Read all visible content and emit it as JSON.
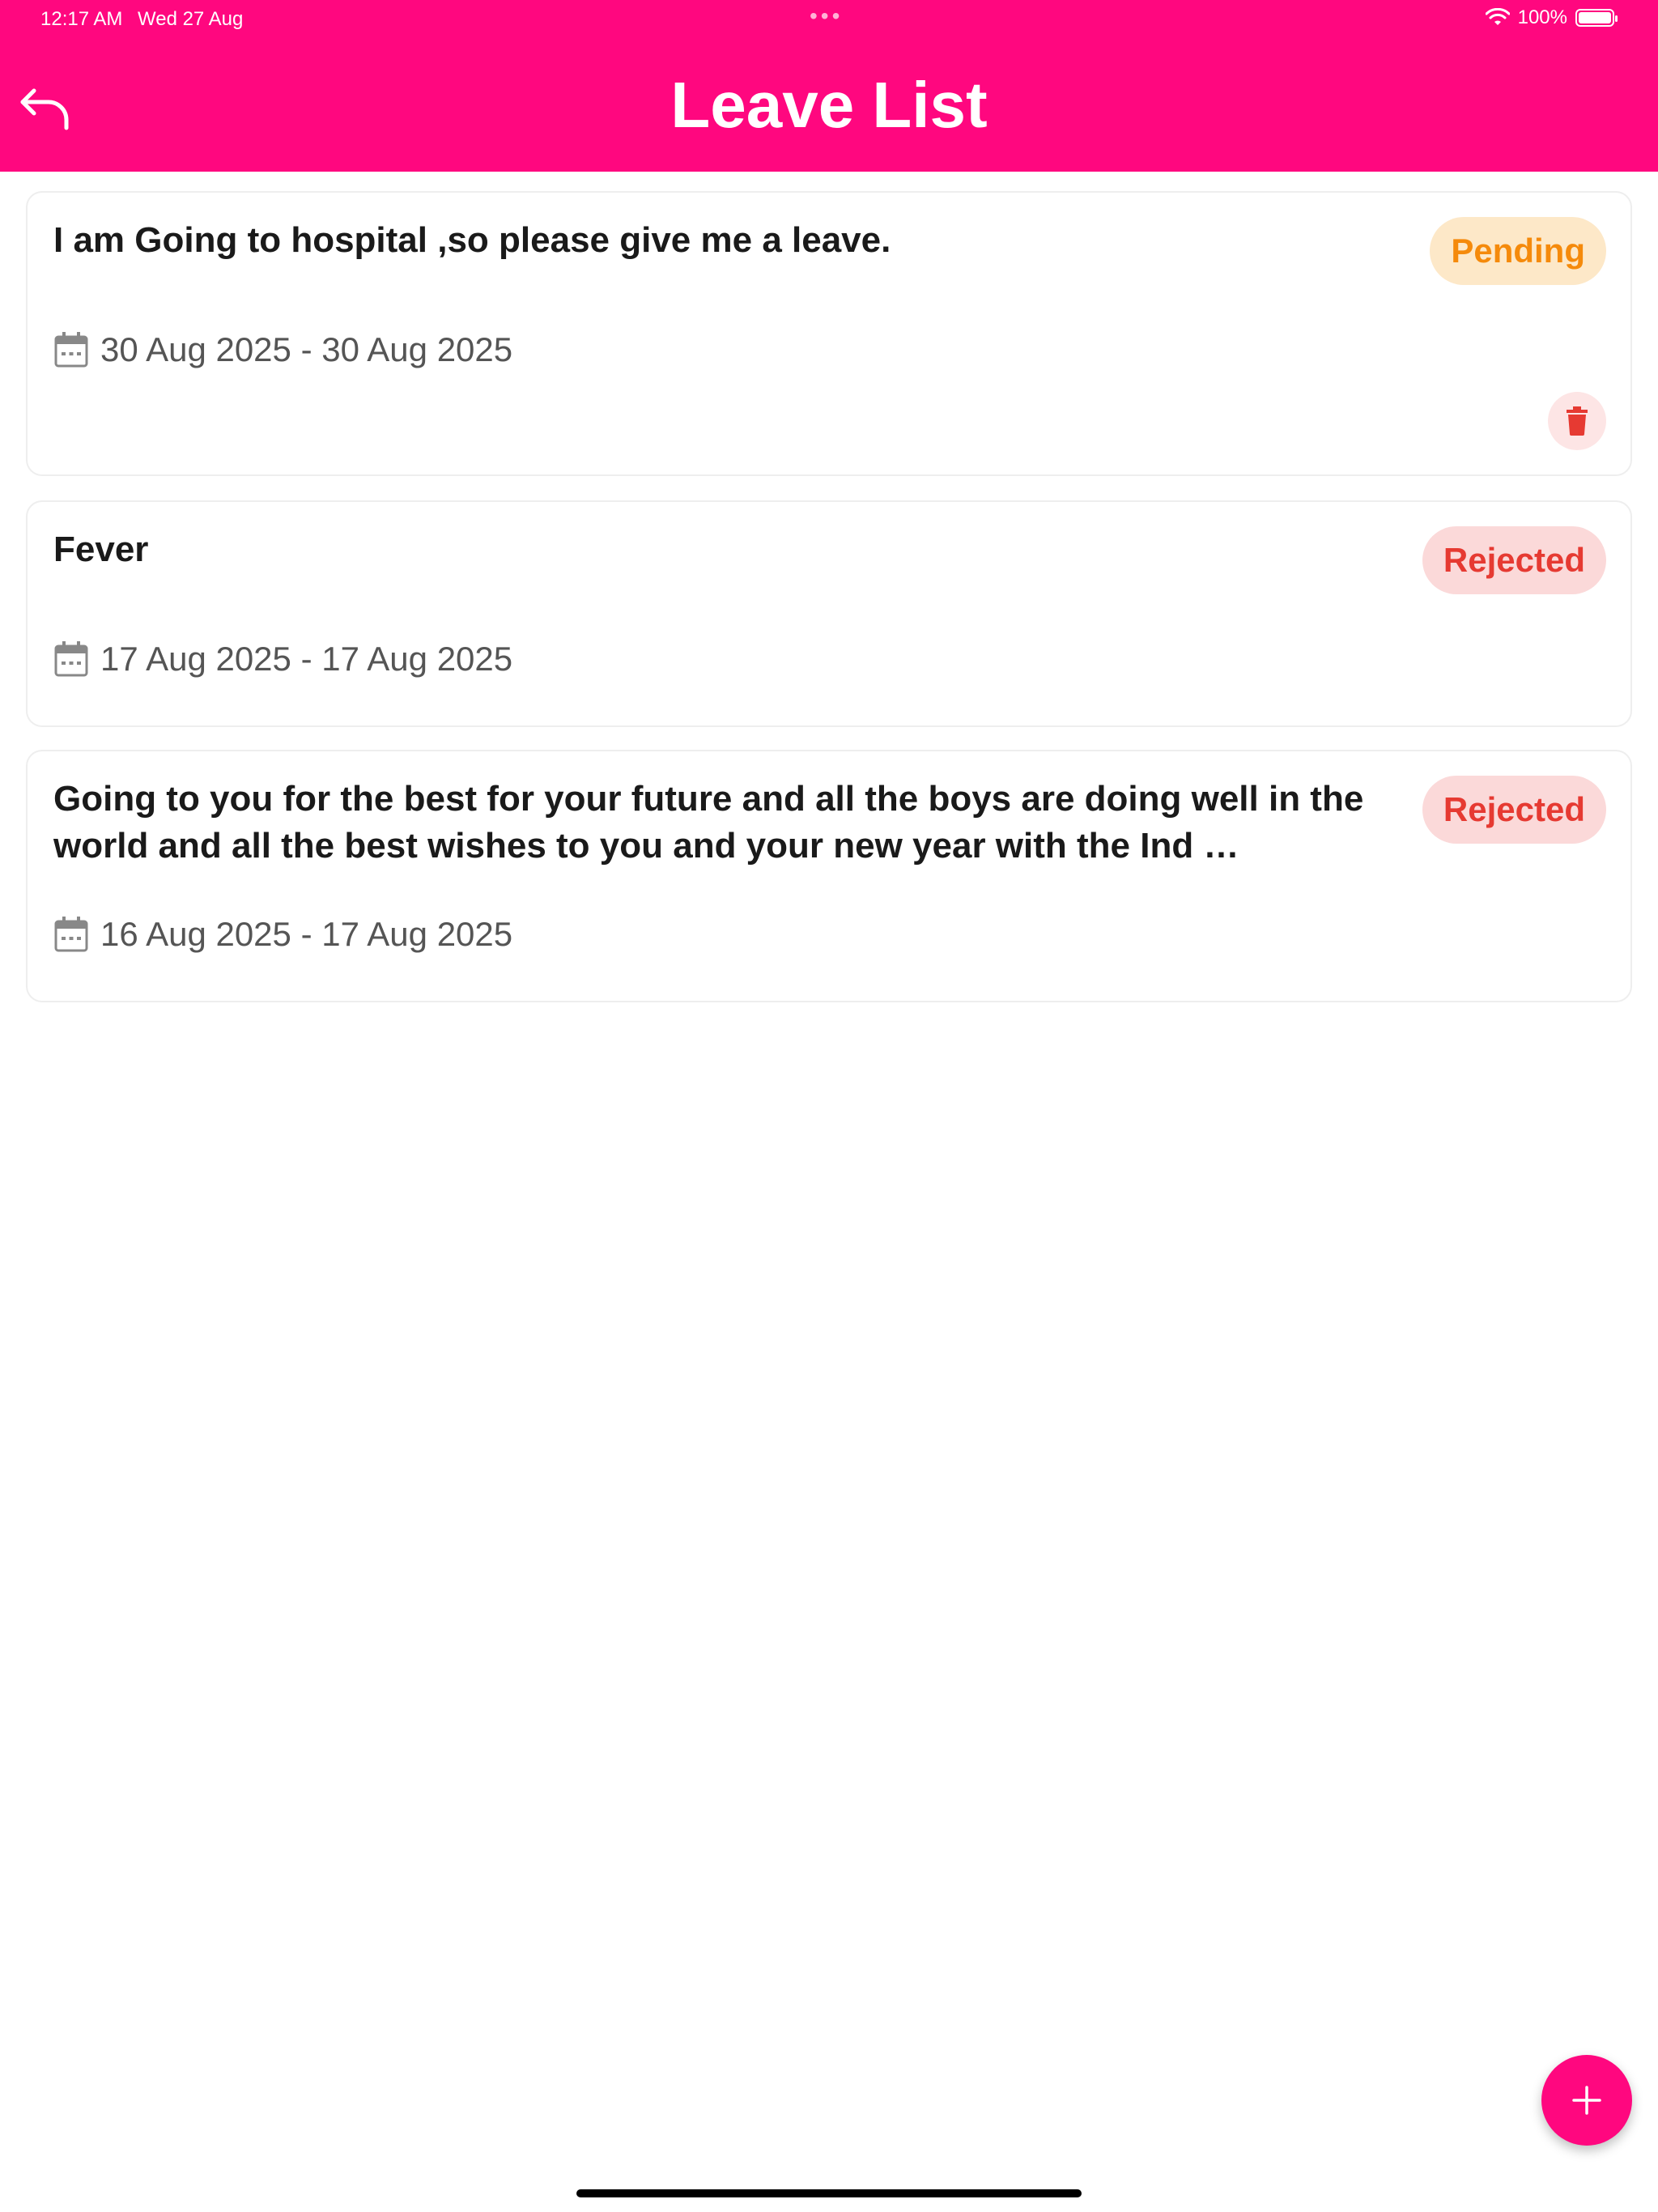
{
  "status_bar": {
    "time": "12:17 AM",
    "date": "Wed 27 Aug",
    "battery": "100%"
  },
  "header": {
    "title": "Leave List"
  },
  "leaves": [
    {
      "reason": "I am Going to hospital ,so please give me a  leave.",
      "status": "Pending",
      "dates": "30 Aug 2025 - 30 Aug 2025"
    },
    {
      "reason": "Fever",
      "status": "Rejected",
      "dates": "17 Aug 2025 - 17 Aug 2025"
    },
    {
      "reason": "Going to you for the best for your future and all the boys are doing well in the world and all the best wishes to you and your new year with the Ind …",
      "status": "Rejected",
      "dates": "16 Aug 2025 - 17 Aug 2025"
    }
  ],
  "colors": {
    "brand": "#ff077f",
    "pending_text": "#f58a0b",
    "pending_bg": "#fde8c8",
    "rejected_text": "#e63a32",
    "rejected_bg": "#fbd9d9"
  },
  "icons": {
    "back": "back-arrow-icon",
    "calendar": "calendar-icon",
    "delete": "trash-icon",
    "add": "plus-icon",
    "wifi": "wifi-icon",
    "battery": "battery-icon"
  }
}
